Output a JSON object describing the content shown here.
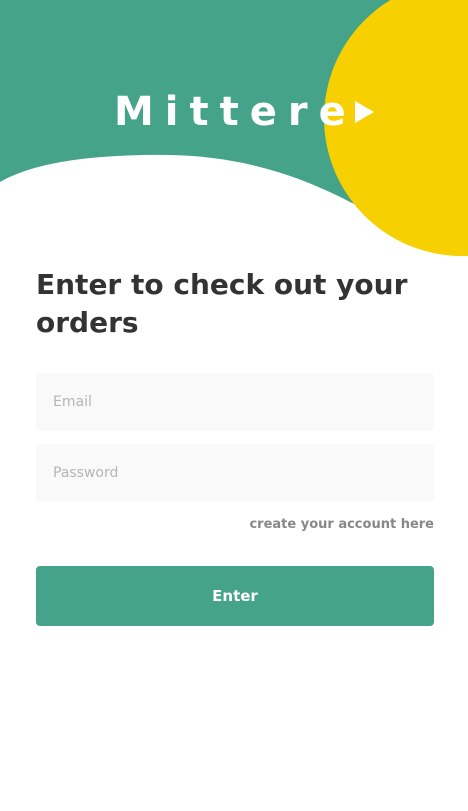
{
  "brand": {
    "name": "Mittere",
    "icon": "play-icon"
  },
  "login": {
    "heading": "Enter to check out your orders",
    "email_placeholder": "Email",
    "password_placeholder": "Password",
    "create_account_link": "create your account here",
    "submit_label": "Enter"
  },
  "colors": {
    "primary_green": "#45a38a",
    "accent_yellow": "#f6d000",
    "heading_text": "#333333",
    "input_background": "#f9f9f9",
    "link_text": "#888888"
  }
}
